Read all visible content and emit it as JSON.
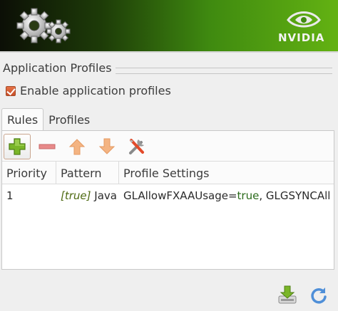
{
  "banner": {
    "logo_text": "NVIDIA",
    "gear_icon": "gears-icon",
    "colors": {
      "dark": "#0c0f06",
      "green": "#63b212"
    }
  },
  "section": {
    "title": "Application Profiles"
  },
  "enable": {
    "label": "Enable application profiles",
    "checked": true,
    "accent": "#d9623a"
  },
  "tabs": [
    {
      "label": "Rules",
      "active": true
    },
    {
      "label": "Profiles",
      "active": false
    }
  ],
  "toolbar": {
    "add": "add-rule-icon",
    "remove": "remove-rule-icon",
    "up": "move-up-icon",
    "down": "move-down-icon",
    "edit": "edit-rule-icon"
  },
  "table": {
    "columns": [
      "Priority",
      "Pattern",
      "Profile Settings"
    ],
    "rows": [
      {
        "priority": "1",
        "pattern_cond": "[true]",
        "pattern_value": "Java",
        "settings_prefix": "GLAllowFXAAUsage=",
        "settings_value": "true",
        "settings_suffix": ", GLGSYNCAll"
      }
    ]
  },
  "footer": {
    "save": "save-icon",
    "reload": "reload-icon"
  }
}
